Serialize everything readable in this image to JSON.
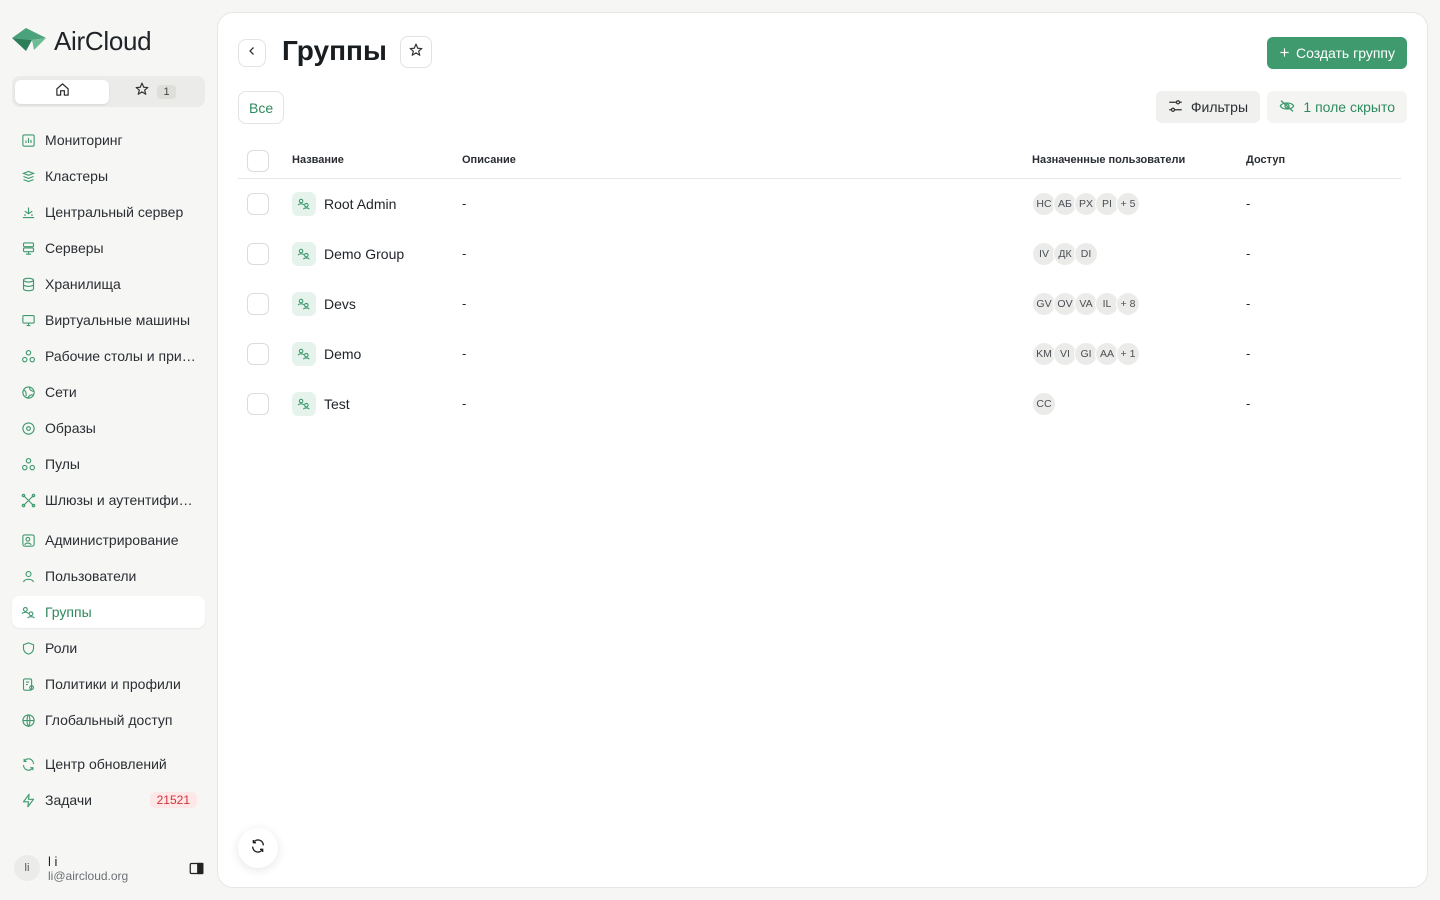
{
  "app": {
    "name": "AirCloud"
  },
  "colors": {
    "accent": "#3f9a6e",
    "accent_text": "#2e8b5e",
    "danger": "#d1343a"
  },
  "quick": {
    "favorites_count": "1"
  },
  "nav": {
    "items": [
      {
        "label": "Мониторинг",
        "icon": "chart-icon"
      },
      {
        "label": "Кластеры",
        "icon": "layers-icon"
      },
      {
        "label": "Центральный сервер",
        "icon": "central-server-icon"
      },
      {
        "label": "Серверы",
        "icon": "server-icon"
      },
      {
        "label": "Хранилища",
        "icon": "database-icon"
      },
      {
        "label": "Виртуальные машины",
        "icon": "monitor-icon"
      },
      {
        "label": "Рабочие столы и приложения",
        "icon": "apps-icon"
      },
      {
        "label": "Сети",
        "icon": "network-icon"
      },
      {
        "label": "Образы",
        "icon": "disc-icon"
      },
      {
        "label": "Пулы",
        "icon": "pools-icon"
      },
      {
        "label": "Шлюзы и аутентификация",
        "icon": "gateway-icon"
      },
      {
        "label": "Администрирование",
        "icon": "admin-icon"
      },
      {
        "label": "Пользователи",
        "icon": "user-icon"
      },
      {
        "label": "Группы",
        "icon": "group-icon"
      },
      {
        "label": "Роли",
        "icon": "shield-icon"
      },
      {
        "label": "Политики и профили",
        "icon": "policy-icon"
      },
      {
        "label": "Глобальный доступ",
        "icon": "globe-icon"
      },
      {
        "label": "Центр обновлений",
        "icon": "refresh-icon"
      },
      {
        "label": "Задачи",
        "icon": "bolt-icon",
        "badge": "21521"
      }
    ],
    "active_index": 13
  },
  "user": {
    "initials": "li",
    "name": "l i",
    "email": "li@aircloud.org"
  },
  "page": {
    "title": "Группы",
    "create_label": "Создать группу",
    "filter_all": "Все",
    "filters_label": "Фильтры",
    "hidden_fields_label": "1 поле скрыто"
  },
  "table": {
    "columns": [
      "Название",
      "Описание",
      "Назначенные пользователи",
      "Доступ"
    ],
    "rows": [
      {
        "name": "Root Admin",
        "description": "-",
        "users": [
          "HC",
          "АБ",
          "PX",
          "PI"
        ],
        "more": "+ 5",
        "access": "-"
      },
      {
        "name": "Demo Group",
        "description": "-",
        "users": [
          "IV",
          "ДК",
          "DI"
        ],
        "more": "",
        "access": "-"
      },
      {
        "name": "Devs",
        "description": "-",
        "users": [
          "GV",
          "OV",
          "VA",
          "IL"
        ],
        "more": "+ 8",
        "access": "-"
      },
      {
        "name": "Demo",
        "description": "-",
        "users": [
          "KM",
          "VI",
          "GI",
          "AA"
        ],
        "more": "+ 1",
        "access": "-"
      },
      {
        "name": "Test",
        "description": "-",
        "users": [
          "CC"
        ],
        "more": "",
        "access": "-"
      }
    ]
  }
}
